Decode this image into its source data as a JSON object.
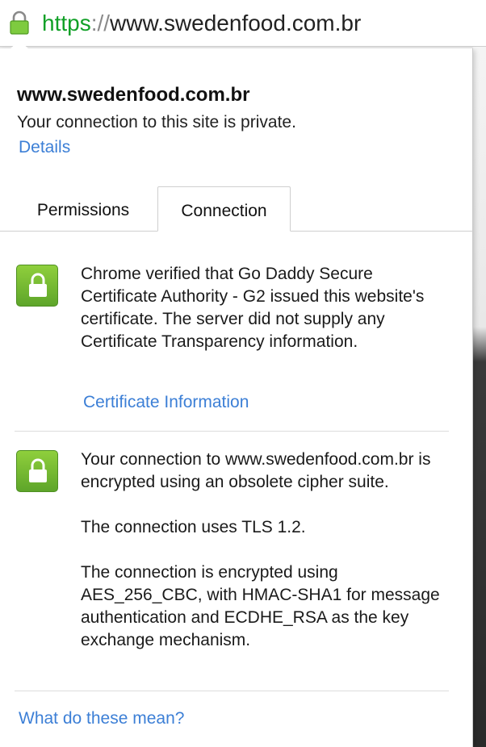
{
  "address_bar": {
    "scheme": "https",
    "separator": "://",
    "host": "www.swedenfood.com.br",
    "lock_icon": "lock-icon",
    "scheme_color": "#11a027"
  },
  "popup": {
    "site_title": "www.swedenfood.com.br",
    "subtitle": "Your connection to this site is private.",
    "details_link": "Details",
    "tabs": [
      {
        "label": "Permissions",
        "selected": false
      },
      {
        "label": "Connection",
        "selected": true
      }
    ],
    "sections": [
      {
        "icon": "lock-icon",
        "paragraphs": [
          "Chrome verified that Go Daddy Secure Certificate Authority - G2 issued this website's certificate. The server did not supply any Certificate Transparency information."
        ],
        "link": "Certificate Information"
      },
      {
        "icon": "lock-icon",
        "paragraphs": [
          "Your connection to www.swedenfood.com.br is encrypted using an obsolete cipher suite.",
          "The connection uses TLS 1.2.",
          "The connection is encrypted using AES_256_CBC, with HMAC-SHA1 for message authentication and ECDHE_RSA as the key exchange mechanism."
        ]
      }
    ],
    "help_link": "What do these mean?",
    "link_color": "#3c7fd6",
    "icon_color": "#6cb52f"
  }
}
